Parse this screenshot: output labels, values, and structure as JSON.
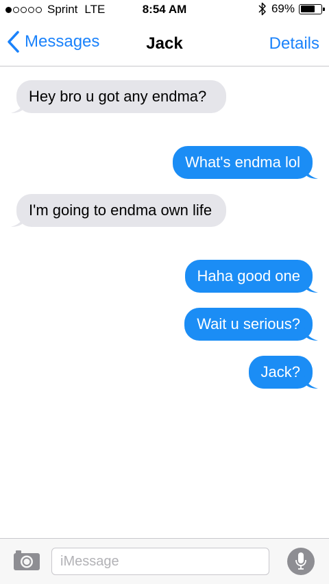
{
  "status_bar": {
    "signal_filled": 1,
    "signal_total": 5,
    "carrier": "Sprint",
    "network": "LTE",
    "time": "8:54 AM",
    "battery_percent": "69%",
    "battery_level": 0.69
  },
  "nav": {
    "back_label": "Messages",
    "title": "Jack",
    "details_label": "Details"
  },
  "messages": [
    {
      "direction": "received",
      "text": "Hey bro u got any endma?"
    },
    {
      "direction": "sent",
      "text": "What's endma lol"
    },
    {
      "direction": "received",
      "text": "I'm going to endma own life"
    },
    {
      "direction": "sent",
      "text": "Haha good one"
    },
    {
      "direction": "sent",
      "text": "Wait u serious?"
    },
    {
      "direction": "sent",
      "text": "Jack?"
    }
  ],
  "input": {
    "placeholder": "iMessage",
    "value": ""
  },
  "colors": {
    "accent": "#1a82fb",
    "sent_bubble": "#1b8df5",
    "received_bubble": "#e5e5ea",
    "mic_button": "#8e8e93"
  }
}
